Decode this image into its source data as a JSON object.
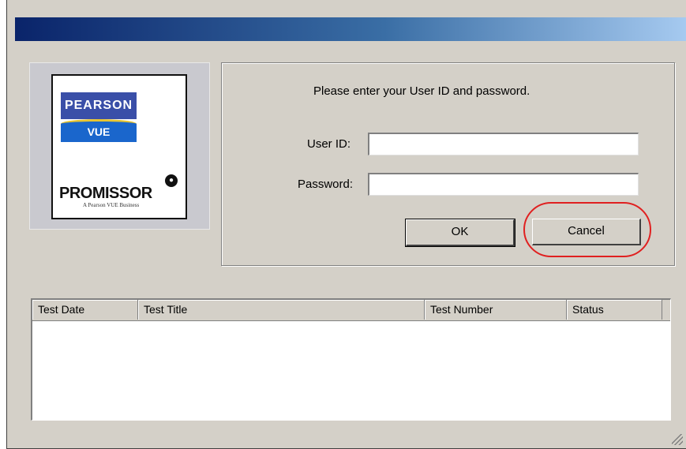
{
  "logo": {
    "pearson": "PEARSON",
    "vue": "VUE",
    "promissor": "PROMISSOR",
    "promissor_tagline": "A Pearson VUE Business"
  },
  "login": {
    "prompt": "Please enter your User ID and password.",
    "user_id_label": "User ID:",
    "user_id_value": "",
    "password_label": "Password:",
    "password_value": "",
    "ok_label": "OK",
    "cancel_label": "Cancel"
  },
  "table": {
    "columns": [
      "Test Date",
      "Test Title",
      "Test Number",
      "Status"
    ],
    "rows": []
  },
  "colors": {
    "title_gradient_start": "#0a246a",
    "title_gradient_end": "#a6caf0",
    "window_bg": "#d4d0c8",
    "highlight_ring": "#e02020"
  }
}
